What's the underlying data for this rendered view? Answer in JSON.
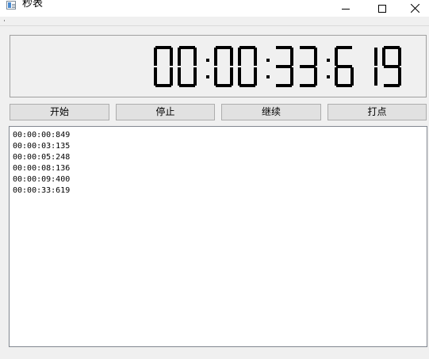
{
  "window": {
    "title": "秒表"
  },
  "display": {
    "time": "00:00:33:619",
    "digit_color": "#000000"
  },
  "buttons": {
    "start": "开始",
    "stop": "停止",
    "resume": "继续",
    "lap": "打点"
  },
  "laps": [
    "00:00:00:849",
    "00:00:03:135",
    "00:00:05:248",
    "00:00:08:136",
    "00:00:09:400",
    "00:00:33:619"
  ]
}
